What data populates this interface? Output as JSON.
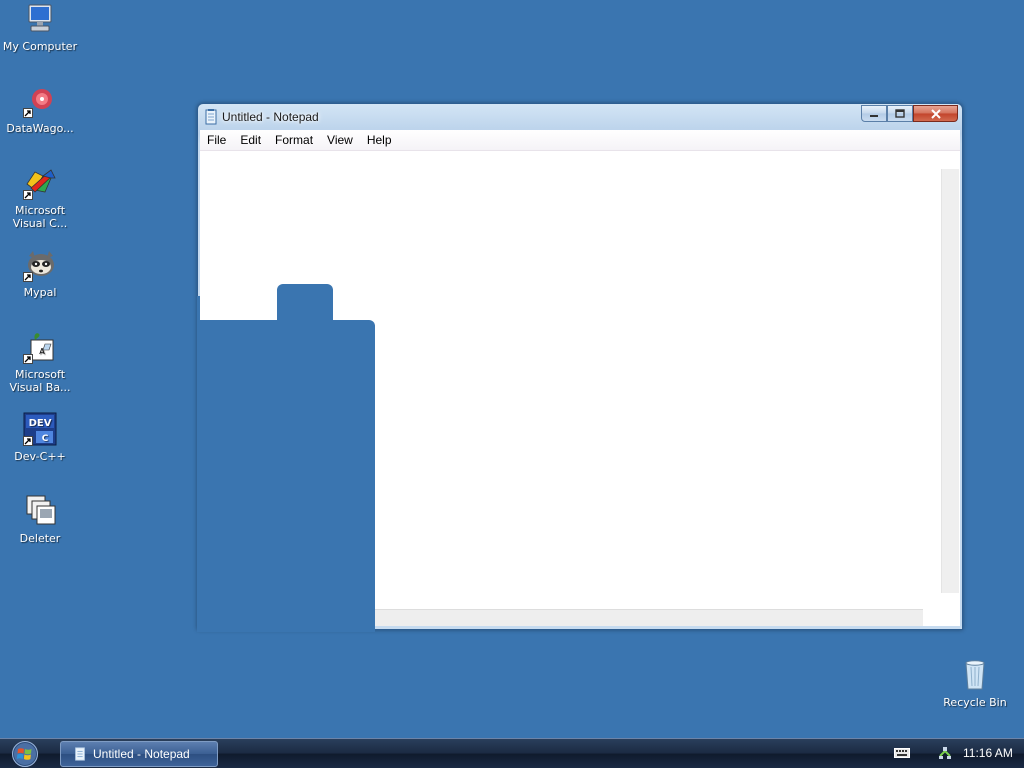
{
  "desktop": {
    "background_color": "#3a75b0",
    "icons": [
      {
        "label": "My Computer",
        "icon": "computer-icon"
      },
      {
        "label": "DataWago...",
        "icon": "datawagon-icon"
      },
      {
        "label": "Microsoft Visual C...",
        "icon": "visual-c-icon"
      },
      {
        "label": "Mypal",
        "icon": "mypal-icon"
      },
      {
        "label": "Microsoft Visual Ba...",
        "icon": "visual-basic-icon"
      },
      {
        "label": "Dev-C++",
        "icon": "dev-cpp-icon"
      },
      {
        "label": "Deleter",
        "icon": "deleter-icon"
      },
      {
        "label": "Recycle Bin",
        "icon": "recycle-bin-icon"
      }
    ]
  },
  "notepad": {
    "title": "Untitled - Notepad",
    "menu": [
      "File",
      "Edit",
      "Format",
      "View",
      "Help"
    ],
    "content": ""
  },
  "taskbar": {
    "task_button_label": "Untitled - Notepad",
    "clock": "11:16 AM"
  }
}
